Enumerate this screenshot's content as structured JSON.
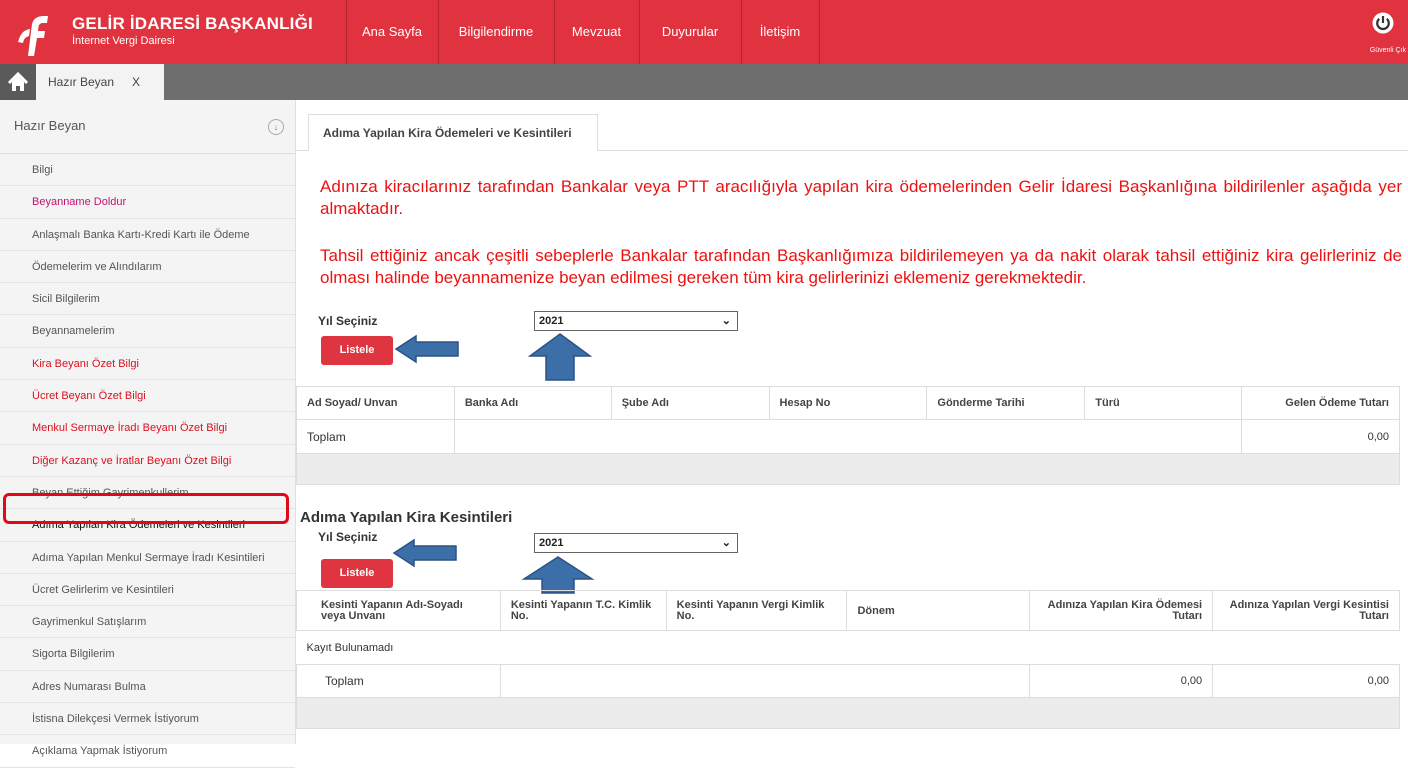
{
  "brand": {
    "title": "GELİR İDARESİ BAŞKANLIĞI",
    "subtitle": "İnternet Vergi Dairesi",
    "color": "#e0333f"
  },
  "nav": [
    "Ana Sayfa",
    "Bilgilendirme",
    "Mevzuat",
    "Duyurular",
    "İletişim"
  ],
  "logout_label": "Güvenli Çık",
  "open_tab": {
    "label": "Hazır Beyan",
    "close": "X"
  },
  "sidebar": {
    "title": "Hazır Beyan",
    "items": [
      {
        "label": "Bilgi",
        "style": "plain"
      },
      {
        "label": "Beyanname Doldur",
        "style": "magenta"
      },
      {
        "label": "Anlaşmalı Banka Kartı-Kredi Kartı ile Ödeme",
        "style": "plain"
      },
      {
        "label": "Ödemelerim ve Alındılarım",
        "style": "plain"
      },
      {
        "label": "Sicil Bilgilerim",
        "style": "plain"
      },
      {
        "label": "Beyannamelerim",
        "style": "plain"
      },
      {
        "label": "Kira Beyanı Özet Bilgi",
        "style": "red"
      },
      {
        "label": "Ücret Beyanı Özet Bilgi",
        "style": "red"
      },
      {
        "label": "Menkul Sermaye İradı Beyanı Özet Bilgi",
        "style": "red"
      },
      {
        "label": "Diğer Kazanç ve İratlar Beyanı Özet Bilgi",
        "style": "red"
      },
      {
        "label": "Beyan Ettiğim Gayrimenkullerim",
        "style": "plain"
      },
      {
        "label": "Adıma Yapılan Kira Ödemeleri ve Kesintileri",
        "style": "hl"
      },
      {
        "label": "Adıma Yapılan Menkul Sermaye İradı Kesintileri",
        "style": "plain"
      },
      {
        "label": "Ücret Gelirlerim ve Kesintileri",
        "style": "plain"
      },
      {
        "label": "Gayrimenkul Satışlarım",
        "style": "plain"
      },
      {
        "label": "Sigorta Bilgilerim",
        "style": "plain"
      },
      {
        "label": "Adres Numarası Bulma",
        "style": "plain"
      },
      {
        "label": "İstisna Dilekçesi Vermek İstiyorum",
        "style": "plain"
      },
      {
        "label": "Açıklama Yapmak İstiyorum",
        "style": "plain"
      }
    ]
  },
  "main": {
    "tab_label": "Adıma Yapılan Kira Ödemeleri ve Kesintileri",
    "notice1": "Adınıza kiracılarınız tarafından Bankalar veya PTT aracılığıyla yapılan kira ödemelerinden Gelir İdaresi Başkanlığına bildirilenler aşağıda yer almaktadır.",
    "notice2": "Tahsil ettiğiniz ancak çeşitli sebeplerle Bankalar tarafından Başkanlığımıza bildirilemeyen ya da nakit olarak tahsil ettiğiniz kira gelirleriniz de olması halinde beyannamenize beyan edilmesi gereken tüm kira gelirlerinizi eklemeniz gerekmektedir.",
    "year_label": "Yıl Seçiniz",
    "year_value": "2021",
    "list_button": "Listele",
    "payments_table": {
      "headers": [
        "Ad Soyad/ Unvan",
        "Banka Adı",
        "Şube Adı",
        "Hesap No",
        "Gönderme Tarihi",
        "Türü",
        "Gelen Ödeme Tutarı"
      ],
      "total_label": "Toplam",
      "total_value": "0,00"
    },
    "section2_title": "Adıma Yapılan Kira Kesintileri",
    "deductions_table": {
      "headers": [
        "Kesinti Yapanın Adı-Soyadı veya Unvanı",
        "Kesinti Yapanın T.C. Kimlik No.",
        "Kesinti Yapanın Vergi Kimlik No.",
        "Dönem",
        "Adınıza Yapılan Kira Ödemesi Tutarı",
        "Adınıza Yapılan Vergi Kesintisi Tutarı"
      ],
      "empty_label": "Kayıt Bulunamadı",
      "total_label": "Toplam",
      "total_payment": "0,00",
      "total_tax": "0,00"
    }
  },
  "annotation_color": "#3c6fa8",
  "highlight_color": "#e00a17"
}
